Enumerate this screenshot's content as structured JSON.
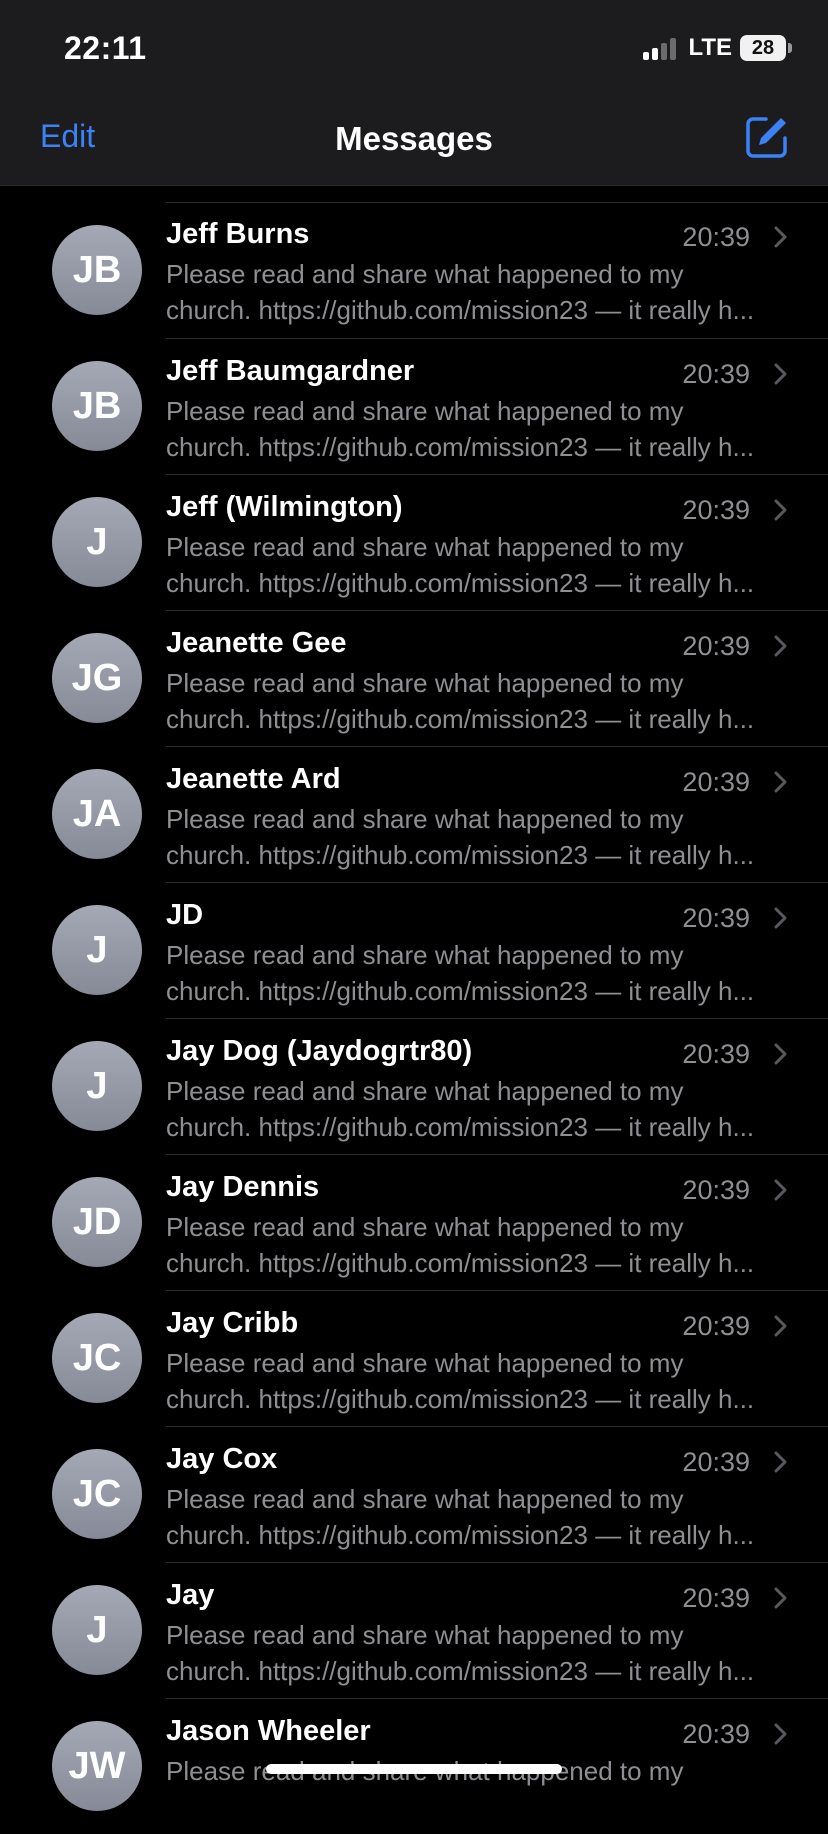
{
  "status": {
    "time": "22:11",
    "network": "LTE",
    "battery": "28"
  },
  "nav": {
    "edit_label": "Edit",
    "title": "Messages"
  },
  "conversations": [
    {
      "initials": "JB",
      "name": "Jeff Burns",
      "time": "20:39",
      "preview_line1": "Please read and share what happened to my",
      "preview_line2": "church. https://github.com/mission23 — it really h..."
    },
    {
      "initials": "JB",
      "name": "Jeff Baumgardner",
      "time": "20:39",
      "preview_line1": "Please read and share what happened to my",
      "preview_line2": "church. https://github.com/mission23 — it really h..."
    },
    {
      "initials": "J",
      "name": "Jeff (Wilmington)",
      "time": "20:39",
      "preview_line1": "Please read and share what happened to my",
      "preview_line2": "church. https://github.com/mission23 — it really h..."
    },
    {
      "initials": "JG",
      "name": "Jeanette Gee",
      "time": "20:39",
      "preview_line1": "Please read and share what happened to my",
      "preview_line2": "church. https://github.com/mission23 — it really h..."
    },
    {
      "initials": "JA",
      "name": "Jeanette Ard",
      "time": "20:39",
      "preview_line1": "Please read and share what happened to my",
      "preview_line2": "church. https://github.com/mission23 — it really h..."
    },
    {
      "initials": "J",
      "name": "JD",
      "time": "20:39",
      "preview_line1": "Please read and share what happened to my",
      "preview_line2": "church. https://github.com/mission23 — it really h..."
    },
    {
      "initials": "J",
      "name": "Jay Dog (Jaydogrtr80)",
      "time": "20:39",
      "preview_line1": "Please read and share what happened to my",
      "preview_line2": "church. https://github.com/mission23 — it really h..."
    },
    {
      "initials": "JD",
      "name": "Jay Dennis",
      "time": "20:39",
      "preview_line1": "Please read and share what happened to my",
      "preview_line2": "church. https://github.com/mission23 — it really h..."
    },
    {
      "initials": "JC",
      "name": "Jay Cribb",
      "time": "20:39",
      "preview_line1": "Please read and share what happened to my",
      "preview_line2": "church. https://github.com/mission23 — it really h..."
    },
    {
      "initials": "JC",
      "name": "Jay Cox",
      "time": "20:39",
      "preview_line1": "Please read and share what happened to my",
      "preview_line2": "church. https://github.com/mission23 — it really h..."
    },
    {
      "initials": "J",
      "name": "Jay",
      "time": "20:39",
      "preview_line1": "Please read and share what happened to my",
      "preview_line2": "church. https://github.com/mission23 — it really h..."
    },
    {
      "initials": "JW",
      "name": "Jason Wheeler",
      "time": "20:39",
      "preview_line1": "Please read and share what happened to my",
      "preview_line2": ""
    }
  ],
  "colors": {
    "accent": "#3b82f6",
    "background": "#000000",
    "header": "#1c1c1e",
    "secondary_text": "#8e8e93"
  },
  "icons": {
    "compose": "compose-icon",
    "chevron": "chevron-right-icon",
    "signal": "cellular-signal-icon",
    "battery": "battery-icon"
  }
}
